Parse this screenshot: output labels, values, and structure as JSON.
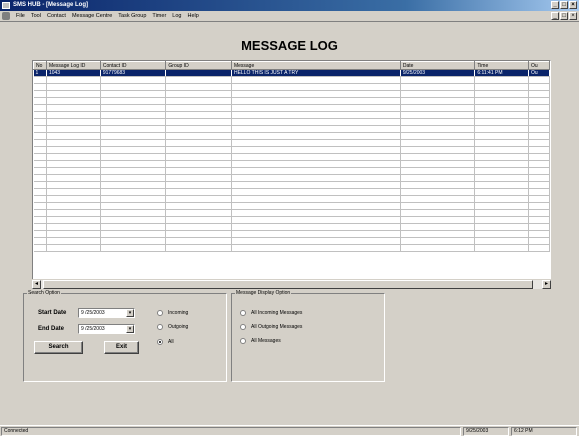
{
  "window": {
    "title": "SMS HUB - [Message Log]"
  },
  "menu": [
    "File",
    "Tool",
    "Contact",
    "Message Centre",
    "Task Group",
    "Timer",
    "Log",
    "Help"
  ],
  "page": {
    "title": "MESSAGE LOG"
  },
  "grid": {
    "columns": [
      "No",
      "Message Log ID",
      "Contact ID",
      "Group ID",
      "Message",
      "Date",
      "Time",
      "Ou"
    ],
    "rows": [
      [
        "1",
        "1043",
        "91779683",
        "",
        "HELLO THIS IS JUST A TRY",
        "9/25/2003",
        "6:11:41 PM",
        "Ou"
      ]
    ]
  },
  "search": {
    "legend": "Search Option",
    "start_label": "Start Date",
    "start_value": "9 /25/2003",
    "end_label": "End Date",
    "end_value": "9 /25/2003",
    "radios": [
      "Incoming",
      "Outgoing",
      "All"
    ],
    "selected": "All",
    "search_button": "Search",
    "exit_button": "Exit"
  },
  "display": {
    "legend": "Message Display Option",
    "options": [
      "All Incoming Messages",
      "All Outgoing Messages",
      "All Messages"
    ]
  },
  "status": {
    "text": "Connected",
    "date": "9/25/2003",
    "time": "6:12 PM"
  }
}
